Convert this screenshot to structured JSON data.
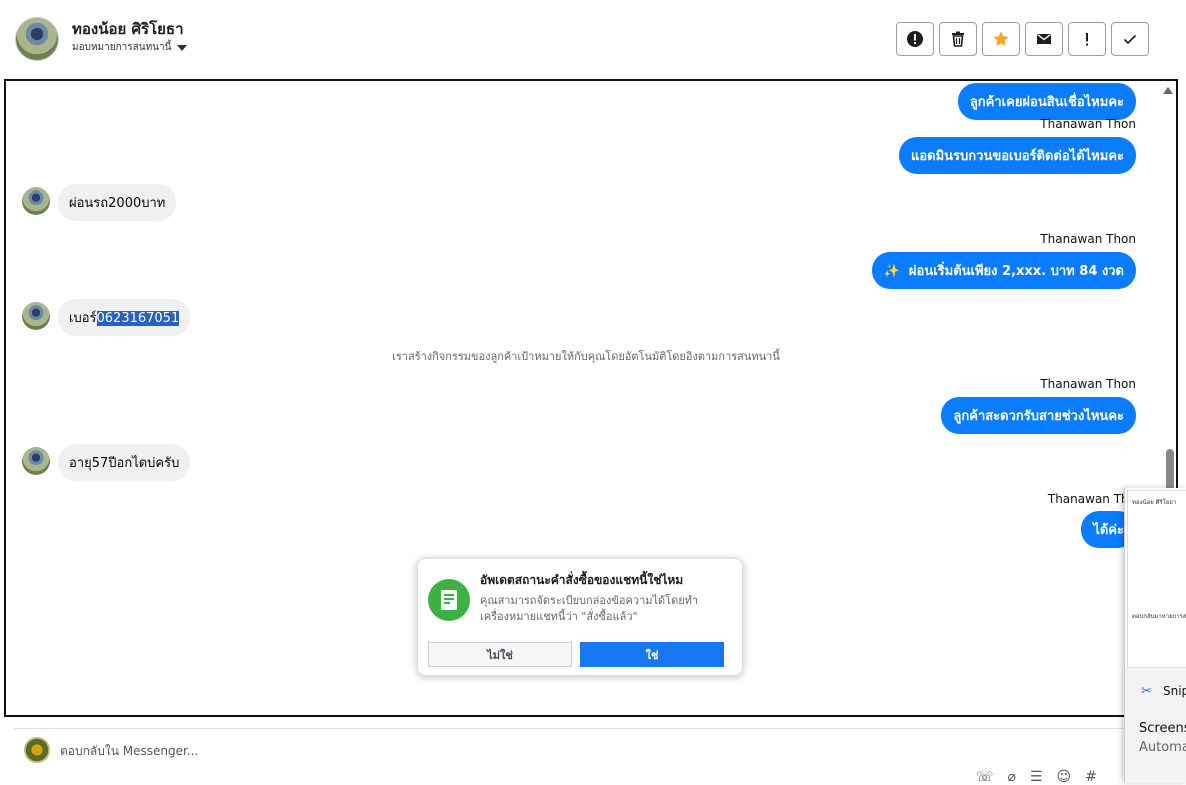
{
  "header": {
    "name": "ทองน้อย ศิริโยธา",
    "assign_label": "มอบหมายการสนทนานี้"
  },
  "chat": {
    "messages": [
      {
        "text": "ลูกค้าเคยผ่อนสินเชื่อไหมคะ"
      },
      {
        "sender": "Thanawan Thon",
        "text": "แอดมินรบกวนขอเบอร์ติดต่อได้ไหมคะ"
      },
      {
        "text": "ผ่อนรถ2000บาท"
      },
      {
        "sender": "Thanawan Thon",
        "text": "ผ่อนเริ่มต้นเพียง 2,xxx. บาท 84 งวด",
        "emoji": "✨"
      },
      {
        "text_prefix": "เบอร์",
        "text_selected": "0623167051"
      },
      {
        "text": "เราสร้างกิจกรรมของลูกค้าเป้าหมายให้กับคุณโดยอัตโนมัติโดยอิงตามการสนทนานี้"
      },
      {
        "sender": "Thanawan Thon",
        "text": "ลูกค้าสะดวกรับสายช่วงไหนคะ"
      },
      {
        "text": "อายุ57ปีอกไดบ่ครับ"
      },
      {
        "sender": "Thanawan Tho",
        "text": "ได้ค่ะ"
      }
    ]
  },
  "modal": {
    "title": "อัพเดตสถานะคำสั่งซื้อของแชทนี้ใช่ไหม",
    "body": "คุณสามารถจัดระเบียบกล่องข้อความได้โดยทำเครื่องหมายแชทนี้ว่า \"สั่งซื้อแล้ว\"",
    "no_label": "ไม่ใช่",
    "yes_label": "ใช่"
  },
  "reply": {
    "placeholder": "ตอบกลับใน Messenger..."
  },
  "snip_overlay": {
    "thumb_name": "ทองน้อย ศิริโยธา",
    "thumb_text": "ตอบกลับมาหายการสนทนานี้",
    "title": "Snip",
    "text1": "Screens",
    "text2": "Automa"
  },
  "colors": {
    "accent_blue": "#0a7cff",
    "incoming_grey": "#f0f0f0",
    "confirm_green": "#3cb043"
  }
}
